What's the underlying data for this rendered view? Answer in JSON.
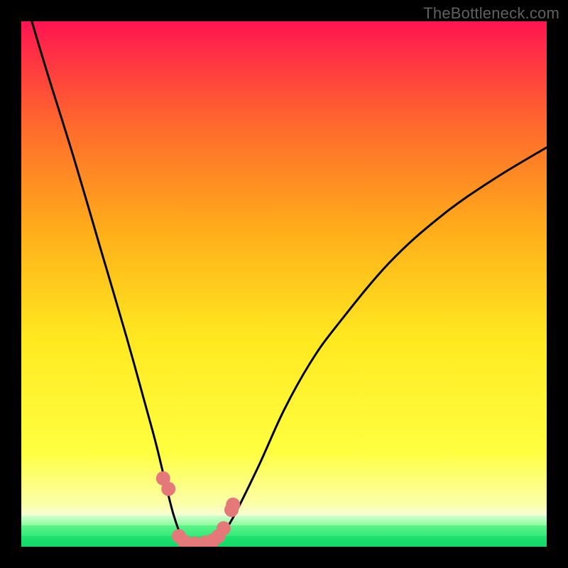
{
  "watermark": "TheBottleneck.com",
  "chart_data": {
    "type": "line",
    "title": "",
    "xlabel": "",
    "ylabel": "",
    "xlim": [
      0,
      100
    ],
    "ylim": [
      0,
      100
    ],
    "series": [
      {
        "name": "bottleneck-curve",
        "x": [
          2,
          5,
          10,
          15,
          20,
          25,
          27,
          29,
          31,
          33,
          35,
          37,
          40,
          45,
          50,
          55,
          60,
          70,
          80,
          90,
          100
        ],
        "y": [
          100,
          90,
          74,
          57,
          40,
          22,
          14,
          6,
          1,
          0,
          0,
          1,
          5,
          15,
          26,
          35,
          42,
          54,
          63,
          70,
          76
        ]
      }
    ],
    "markers": {
      "name": "highlighted-points",
      "color": "#e57878",
      "points": [
        {
          "x": 27.0,
          "y": 13
        },
        {
          "x": 28.0,
          "y": 11
        },
        {
          "x": 30.0,
          "y": 2
        },
        {
          "x": 31.0,
          "y": 1
        },
        {
          "x": 33.0,
          "y": 0.6
        },
        {
          "x": 35.0,
          "y": 0.8
        },
        {
          "x": 36.5,
          "y": 1.2
        },
        {
          "x": 37.5,
          "y": 2
        },
        {
          "x": 38.5,
          "y": 3.5
        },
        {
          "x": 40.0,
          "y": 7
        },
        {
          "x": 40.3,
          "y": 8
        }
      ]
    },
    "background_bands": [
      {
        "y_from": 100,
        "y_to": 94,
        "color_top": "#ff1452",
        "color_bottom": "#ff2f45"
      },
      {
        "y_from": 94,
        "y_to": 80,
        "color_top": "#ff2f45",
        "color_bottom": "#ff6a2c"
      },
      {
        "y_from": 80,
        "y_to": 60,
        "color_top": "#ff6a2c",
        "color_bottom": "#ffae1a"
      },
      {
        "y_from": 60,
        "y_to": 40,
        "color_top": "#ffae1a",
        "color_bottom": "#ffe820"
      },
      {
        "y_from": 40,
        "y_to": 18,
        "color_top": "#ffe820",
        "color_bottom": "#ffff40"
      },
      {
        "y_from": 18,
        "y_to": 8,
        "color_top": "#ffff40",
        "color_bottom": "#fbffaa"
      },
      {
        "y_from": 8,
        "y_to": 6,
        "color_top": "#fbffaa",
        "color_bottom": "#f6ffd8"
      },
      {
        "y_from": 6,
        "y_to": 4,
        "color_top": "#d4ffcf",
        "color_bottom": "#8dfca0"
      },
      {
        "y_from": 4,
        "y_to": 2,
        "color_top": "#5cf48a",
        "color_bottom": "#35ea77"
      },
      {
        "y_from": 2,
        "y_to": 0,
        "color_top": "#1fe170",
        "color_bottom": "#13d868"
      }
    ]
  }
}
